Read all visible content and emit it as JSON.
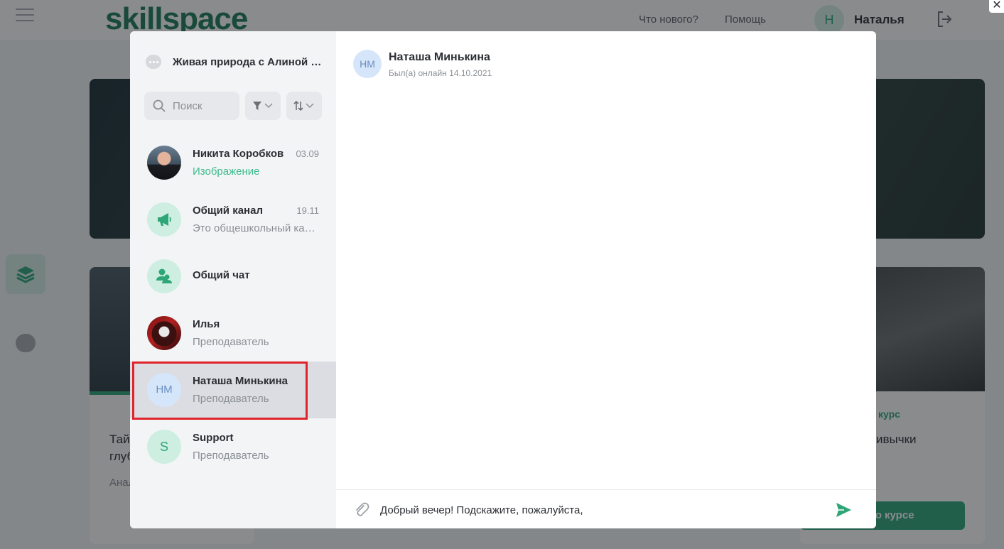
{
  "background": {
    "logo": "skillspace",
    "nav": [
      "Что нового?",
      "Помощь"
    ],
    "user_initial": "Н",
    "user_name": "Наталья",
    "cards": [
      {
        "title": "Тай",
        "title2": "глуб",
        "subtitle": "Анал"
      },
      {
        "tag": "курс",
        "title": "ивычки",
        "button": "ьше о курсе"
      }
    ]
  },
  "chat": {
    "course_title": "Живая природа с Алиной С...",
    "search": {
      "placeholder": "Поиск",
      "value": ""
    },
    "items": [
      {
        "name": "Никита Коробков",
        "date": "03.09",
        "subtitle": "Изображение",
        "avatar": "photo",
        "subtitle_color": "#3dbb8c"
      },
      {
        "name": "Общий канал",
        "date": "19.11",
        "subtitle": "Это общешкольный канал",
        "avatar": "megaphone-icon"
      },
      {
        "name": "Общий чат",
        "date": "",
        "subtitle": "",
        "avatar": "users-icon"
      },
      {
        "name": "Илья",
        "date": "",
        "subtitle": "Преподаватель",
        "avatar": "photo"
      },
      {
        "name": "Наташа Минькина",
        "date": "",
        "subtitle": "Преподаватель",
        "avatar_text": "НМ",
        "active": true
      },
      {
        "name": "Support",
        "date": "",
        "subtitle": "Преподаватель",
        "avatar_text": "S"
      }
    ],
    "active_chat": {
      "initials": "НМ",
      "name": "Наташа Минькина",
      "status": "Был(а) онлайн 14.10.2021"
    },
    "composer": {
      "value": "Добрый вечер! Подскажите, пожалуйста, ",
      "placeholder": ""
    }
  },
  "colors": {
    "accent": "#2fa678",
    "highlight": "#e0242b",
    "active_row": "#dcdde2"
  }
}
